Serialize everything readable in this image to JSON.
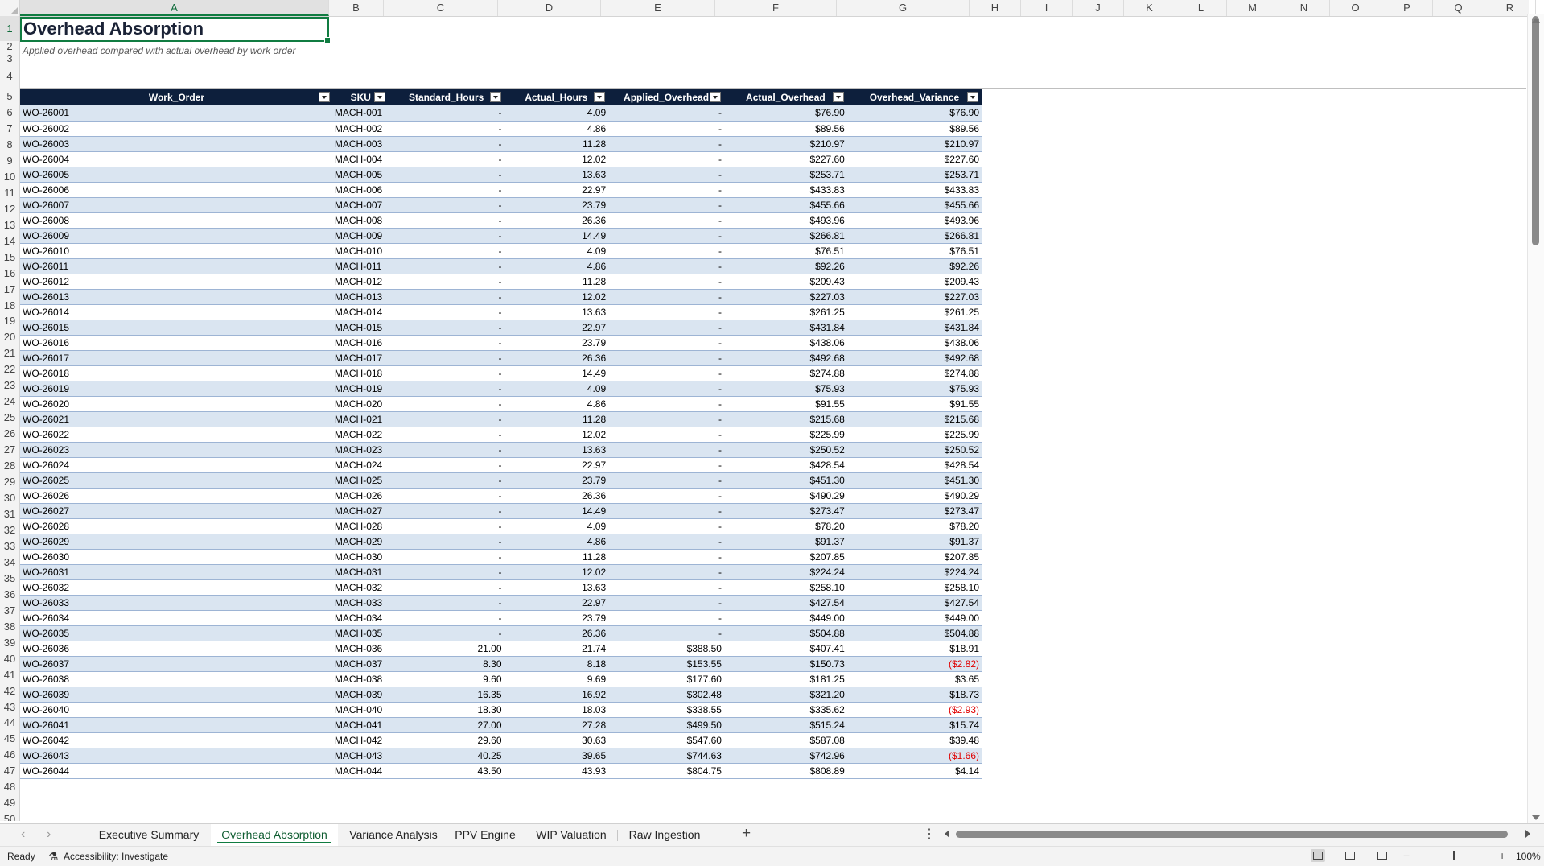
{
  "sheet": {
    "title": "Overhead Absorption",
    "subtitle": "Applied overhead compared with actual overhead by work order"
  },
  "columns": [
    "A",
    "B",
    "C",
    "D",
    "E",
    "F",
    "G",
    "H",
    "I",
    "J",
    "K",
    "L",
    "M",
    "N",
    "O",
    "P",
    "Q",
    "R"
  ],
  "row_numbers": [
    1,
    2,
    3,
    4,
    5,
    6,
    7,
    8,
    9,
    10,
    11,
    12,
    13,
    14,
    15,
    16,
    17,
    18,
    19,
    20,
    21,
    22,
    23,
    24,
    25,
    26,
    27,
    28,
    29,
    30,
    31,
    32,
    33,
    34,
    35,
    36,
    37,
    38,
    39,
    40,
    41,
    42,
    43,
    44,
    45,
    46,
    47,
    48,
    49,
    50
  ],
  "table": {
    "headers": [
      "Work_Order",
      "SKU",
      "Standard_Hours",
      "Actual_Hours",
      "Applied_Overhead",
      "Actual_Overhead",
      "Overhead_Variance"
    ],
    "rows": [
      [
        "WO-26001",
        "MACH-001",
        "-",
        "4.09",
        "-",
        "$76.90",
        "$76.90"
      ],
      [
        "WO-26002",
        "MACH-002",
        "-",
        "4.86",
        "-",
        "$89.56",
        "$89.56"
      ],
      [
        "WO-26003",
        "MACH-003",
        "-",
        "11.28",
        "-",
        "$210.97",
        "$210.97"
      ],
      [
        "WO-26004",
        "MACH-004",
        "-",
        "12.02",
        "-",
        "$227.60",
        "$227.60"
      ],
      [
        "WO-26005",
        "MACH-005",
        "-",
        "13.63",
        "-",
        "$253.71",
        "$253.71"
      ],
      [
        "WO-26006",
        "MACH-006",
        "-",
        "22.97",
        "-",
        "$433.83",
        "$433.83"
      ],
      [
        "WO-26007",
        "MACH-007",
        "-",
        "23.79",
        "-",
        "$455.66",
        "$455.66"
      ],
      [
        "WO-26008",
        "MACH-008",
        "-",
        "26.36",
        "-",
        "$493.96",
        "$493.96"
      ],
      [
        "WO-26009",
        "MACH-009",
        "-",
        "14.49",
        "-",
        "$266.81",
        "$266.81"
      ],
      [
        "WO-26010",
        "MACH-010",
        "-",
        "4.09",
        "-",
        "$76.51",
        "$76.51"
      ],
      [
        "WO-26011",
        "MACH-011",
        "-",
        "4.86",
        "-",
        "$92.26",
        "$92.26"
      ],
      [
        "WO-26012",
        "MACH-012",
        "-",
        "11.28",
        "-",
        "$209.43",
        "$209.43"
      ],
      [
        "WO-26013",
        "MACH-013",
        "-",
        "12.02",
        "-",
        "$227.03",
        "$227.03"
      ],
      [
        "WO-26014",
        "MACH-014",
        "-",
        "13.63",
        "-",
        "$261.25",
        "$261.25"
      ],
      [
        "WO-26015",
        "MACH-015",
        "-",
        "22.97",
        "-",
        "$431.84",
        "$431.84"
      ],
      [
        "WO-26016",
        "MACH-016",
        "-",
        "23.79",
        "-",
        "$438.06",
        "$438.06"
      ],
      [
        "WO-26017",
        "MACH-017",
        "-",
        "26.36",
        "-",
        "$492.68",
        "$492.68"
      ],
      [
        "WO-26018",
        "MACH-018",
        "-",
        "14.49",
        "-",
        "$274.88",
        "$274.88"
      ],
      [
        "WO-26019",
        "MACH-019",
        "-",
        "4.09",
        "-",
        "$75.93",
        "$75.93"
      ],
      [
        "WO-26020",
        "MACH-020",
        "-",
        "4.86",
        "-",
        "$91.55",
        "$91.55"
      ],
      [
        "WO-26021",
        "MACH-021",
        "-",
        "11.28",
        "-",
        "$215.68",
        "$215.68"
      ],
      [
        "WO-26022",
        "MACH-022",
        "-",
        "12.02",
        "-",
        "$225.99",
        "$225.99"
      ],
      [
        "WO-26023",
        "MACH-023",
        "-",
        "13.63",
        "-",
        "$250.52",
        "$250.52"
      ],
      [
        "WO-26024",
        "MACH-024",
        "-",
        "22.97",
        "-",
        "$428.54",
        "$428.54"
      ],
      [
        "WO-26025",
        "MACH-025",
        "-",
        "23.79",
        "-",
        "$451.30",
        "$451.30"
      ],
      [
        "WO-26026",
        "MACH-026",
        "-",
        "26.36",
        "-",
        "$490.29",
        "$490.29"
      ],
      [
        "WO-26027",
        "MACH-027",
        "-",
        "14.49",
        "-",
        "$273.47",
        "$273.47"
      ],
      [
        "WO-26028",
        "MACH-028",
        "-",
        "4.09",
        "-",
        "$78.20",
        "$78.20"
      ],
      [
        "WO-26029",
        "MACH-029",
        "-",
        "4.86",
        "-",
        "$91.37",
        "$91.37"
      ],
      [
        "WO-26030",
        "MACH-030",
        "-",
        "11.28",
        "-",
        "$207.85",
        "$207.85"
      ],
      [
        "WO-26031",
        "MACH-031",
        "-",
        "12.02",
        "-",
        "$224.24",
        "$224.24"
      ],
      [
        "WO-26032",
        "MACH-032",
        "-",
        "13.63",
        "-",
        "$258.10",
        "$258.10"
      ],
      [
        "WO-26033",
        "MACH-033",
        "-",
        "22.97",
        "-",
        "$427.54",
        "$427.54"
      ],
      [
        "WO-26034",
        "MACH-034",
        "-",
        "23.79",
        "-",
        "$449.00",
        "$449.00"
      ],
      [
        "WO-26035",
        "MACH-035",
        "-",
        "26.36",
        "-",
        "$504.88",
        "$504.88"
      ],
      [
        "WO-26036",
        "MACH-036",
        "21.00",
        "21.74",
        "$388.50",
        "$407.41",
        "$18.91"
      ],
      [
        "WO-26037",
        "MACH-037",
        "8.30",
        "8.18",
        "$153.55",
        "$150.73",
        "($2.82)"
      ],
      [
        "WO-26038",
        "MACH-038",
        "9.60",
        "9.69",
        "$177.60",
        "$181.25",
        "$3.65"
      ],
      [
        "WO-26039",
        "MACH-039",
        "16.35",
        "16.92",
        "$302.48",
        "$321.20",
        "$18.73"
      ],
      [
        "WO-26040",
        "MACH-040",
        "18.30",
        "18.03",
        "$338.55",
        "$335.62",
        "($2.93)"
      ],
      [
        "WO-26041",
        "MACH-041",
        "27.00",
        "27.28",
        "$499.50",
        "$515.24",
        "$15.74"
      ],
      [
        "WO-26042",
        "MACH-042",
        "29.60",
        "30.63",
        "$547.60",
        "$587.08",
        "$39.48"
      ],
      [
        "WO-26043",
        "MACH-043",
        "40.25",
        "39.65",
        "$744.63",
        "$742.96",
        "($1.66)"
      ],
      [
        "WO-26044",
        "MACH-044",
        "43.50",
        "43.93",
        "$804.75",
        "$808.89",
        "$4.14"
      ]
    ]
  },
  "tabs": [
    {
      "label": "Executive Summary",
      "active": false
    },
    {
      "label": "Overhead Absorption",
      "active": true
    },
    {
      "label": "Variance Analysis",
      "active": false
    },
    {
      "label": "PPV Engine",
      "active": false
    },
    {
      "label": "WIP Valuation",
      "active": false
    },
    {
      "label": "Raw Ingestion",
      "active": false
    }
  ],
  "status": {
    "ready": "Ready",
    "accessibility": "Accessibility: Investigate",
    "zoom": "100%"
  },
  "colors": {
    "header_bg": "#0d1f3c",
    "band": "#dae5f1",
    "negative": "#e00000",
    "accent": "#107c41"
  },
  "icons": {
    "filter": "filter-dropdown-icon",
    "add_sheet": "plus-icon",
    "accessibility": "accessibility-icon"
  }
}
